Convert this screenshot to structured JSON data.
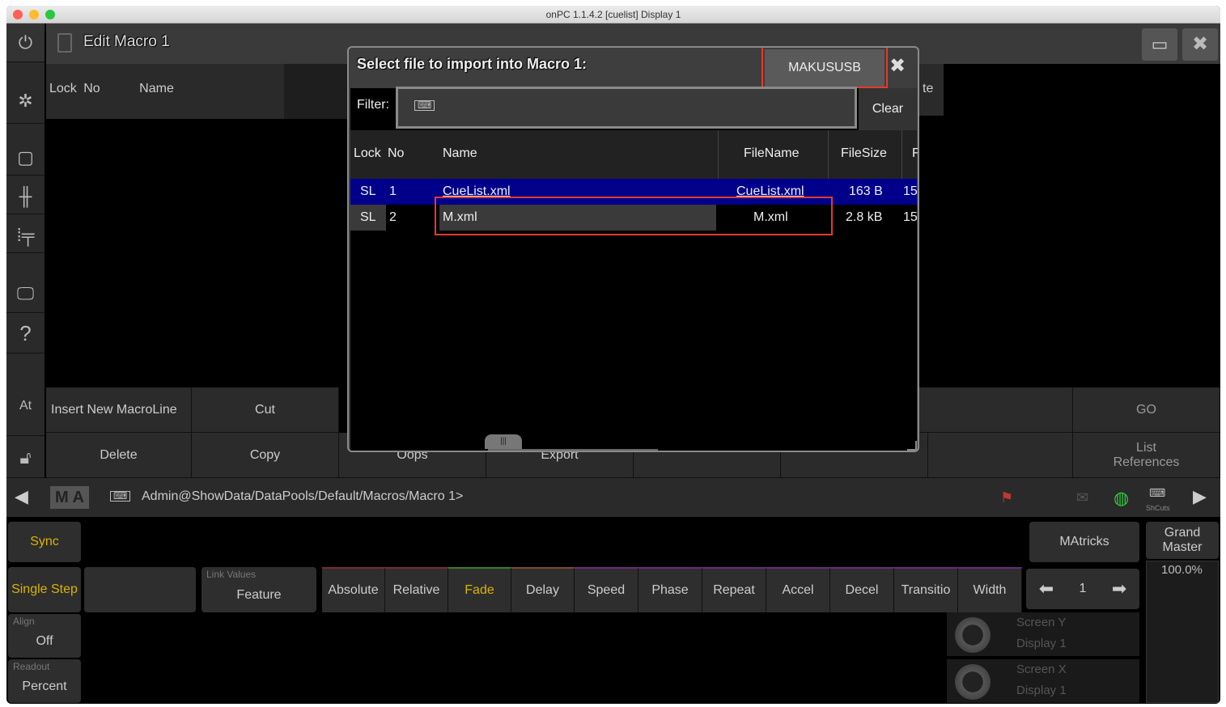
{
  "window": {
    "title": "onPC 1.1.4.2 [cuelist] Display 1"
  },
  "header": {
    "title": "Edit Macro 1"
  },
  "sidebar": {
    "at_label": "At",
    "help_label": "?"
  },
  "macro_table": {
    "columns": [
      "Lock",
      "No",
      "Name"
    ],
    "truncated_col": "te"
  },
  "buttons": {
    "insert_new_macroline": "Insert New MacroLine",
    "cut": "Cut",
    "delete": "Delete",
    "copy": "Copy",
    "oops": "Oops",
    "export": "Export",
    "go": "GO",
    "list_references": "List References"
  },
  "command_line": {
    "prompt": "Admin@ShowData/DataPools/Default/Macros/Macro 1>"
  },
  "dialog": {
    "title": "Select file to import into Macro 1:",
    "drive_button": "MAKUSUSB",
    "filter_label": "Filter:",
    "clear_button": "Clear",
    "columns": {
      "lock": "Lock",
      "no": "No",
      "name": "Name",
      "filename": "FileName",
      "filesize": "FileSize",
      "more": "F"
    },
    "rows": [
      {
        "lock": "SL",
        "no": "1",
        "name": "CueList.xml",
        "filename": "CueList.xml",
        "filesize": "163 B",
        "more": "15",
        "selected": true
      },
      {
        "lock": "SL",
        "no": "2",
        "name": "M.xml",
        "filename": "M.xml",
        "filesize": "2.8 kB",
        "more": "15",
        "selected": false
      }
    ],
    "grip": "|||"
  },
  "lower": {
    "sync": "Sync",
    "single_step": "Single Step",
    "align_label": "Align",
    "align_value": "Off",
    "readout_label": "Readout",
    "readout_value": "Percent",
    "link_values_label": "Link Values",
    "link_values_value": "Feature",
    "features": [
      "Absolute",
      "Relative",
      "Fade",
      "Delay",
      "Speed",
      "Phase",
      "Repeat",
      "Accel",
      "Decel",
      "Transitio",
      "Width"
    ],
    "matricks": "MAtricks",
    "grand_master_label": "Grand Master",
    "grand_master_value": "100.0%",
    "page_value": "1",
    "encoders": [
      {
        "top": "Screen Y",
        "bottom": "Display 1"
      },
      {
        "top": "Screen X",
        "bottom": "Display 1"
      }
    ],
    "shcuts": "ShCuts"
  },
  "colors": {
    "selected_row": "#00008b",
    "highlight": "#e53a2e",
    "fade_active": "#d9b400",
    "sync": "#d9b400"
  }
}
